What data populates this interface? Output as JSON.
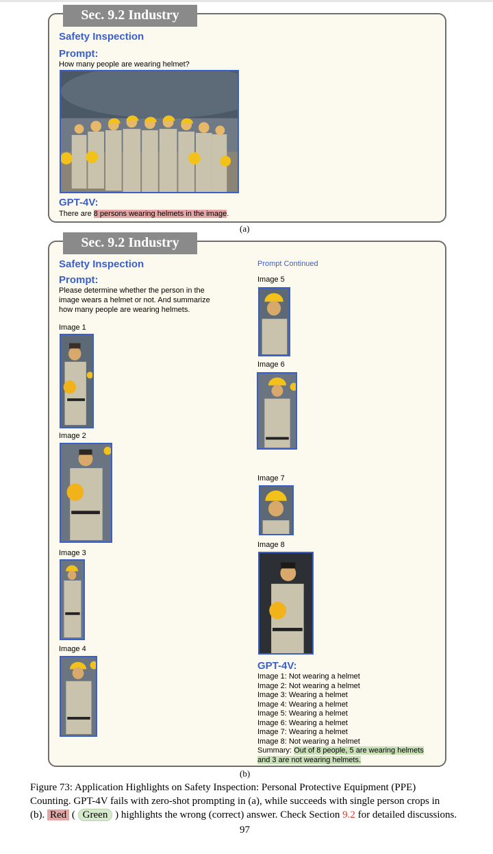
{
  "panel_a": {
    "tab": "Sec. 9.2 Industry",
    "title": "Safety Inspection",
    "prompt_label": "Prompt:",
    "prompt_text": "How many people are wearing helmet?",
    "answer_label": "GPT-4V:",
    "answer_prefix": "There are ",
    "answer_highlight": "8 persons wearing helmets in the image",
    "answer_suffix": ".",
    "sublabel": "(a)"
  },
  "panel_b": {
    "tab": "Sec. 9.2 Industry",
    "title": "Safety Inspection",
    "prompt_label": "Prompt:",
    "prompt_lines": [
      "Please determine whether the person in the",
      "image wears a helmet or not. And summarize",
      "how many people are wearing helmets."
    ],
    "prompt_continued": "Prompt Continued",
    "images": [
      "Image 1",
      "Image 2",
      "Image 3",
      "Image 4",
      "Image 5",
      "Image 6",
      "Image 7",
      "Image 8"
    ],
    "answer_label": "GPT-4V:",
    "answer_lines": [
      "Image 1: Not wearing a helmet",
      "Image 2: Not wearing a helmet",
      "Image 3: Wearing a helmet",
      "Image 4: Wearing a helmet",
      "Image 5: Wearing a helmet",
      "Image 6: Wearing a helmet",
      "Image 7: Wearing a helmet",
      "Image 8: Not wearing a helmet"
    ],
    "summary_prefix": "Summary: ",
    "summary_highlight_1": "Out of 8 people, 5 are wearing helmets",
    "summary_highlight_2": "and 3 are not wearing helmets.",
    "sublabel": "(b)"
  },
  "caption": {
    "line1": "Figure 73: Application Highlights on Safety Inspection: Personal Protective Equipment (PPE)",
    "line2": "Counting. GPT-4V fails with zero-shot prompting in (a), while succeeds with single person crops in",
    "line3_a": "(b). ",
    "red": "Red",
    "mid": " ( ",
    "green": "Green",
    "line3_b": " ) highlights the wrong (correct) answer. Check Section ",
    "section_ref": "9.2",
    "line3_c": " for detailed discussions."
  },
  "page_number": "97"
}
